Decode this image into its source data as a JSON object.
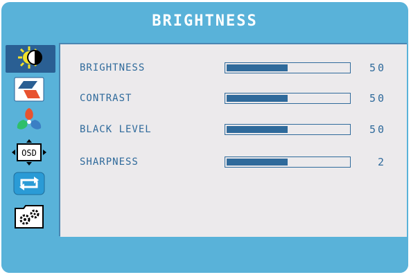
{
  "header": {
    "title": "BRIGHTNESS"
  },
  "sidebar": {
    "items": [
      {
        "icon": "brightness-icon",
        "selected": true
      },
      {
        "icon": "color-icon",
        "selected": false
      },
      {
        "icon": "rgb-icon",
        "selected": false
      },
      {
        "icon": "osd-position-icon",
        "osd_text": "OSD",
        "selected": false
      },
      {
        "icon": "reset-icon",
        "selected": false
      },
      {
        "icon": "setup-icon",
        "selected": false
      }
    ]
  },
  "settings": [
    {
      "label": "BRIGHTNESS",
      "value": "50",
      "level": 0.5
    },
    {
      "label": "CONTRAST",
      "value": "50",
      "level": 0.5
    },
    {
      "label": "BLACK LEVEL",
      "value": "50",
      "level": 0.5
    },
    {
      "label": "SHARPNESS",
      "value": "2",
      "level": 0.5
    }
  ],
  "colors": {
    "frame": "#59b2d9",
    "selected": "#2a5f93",
    "panel": "#eceaec",
    "text": "#2f6a9b"
  }
}
